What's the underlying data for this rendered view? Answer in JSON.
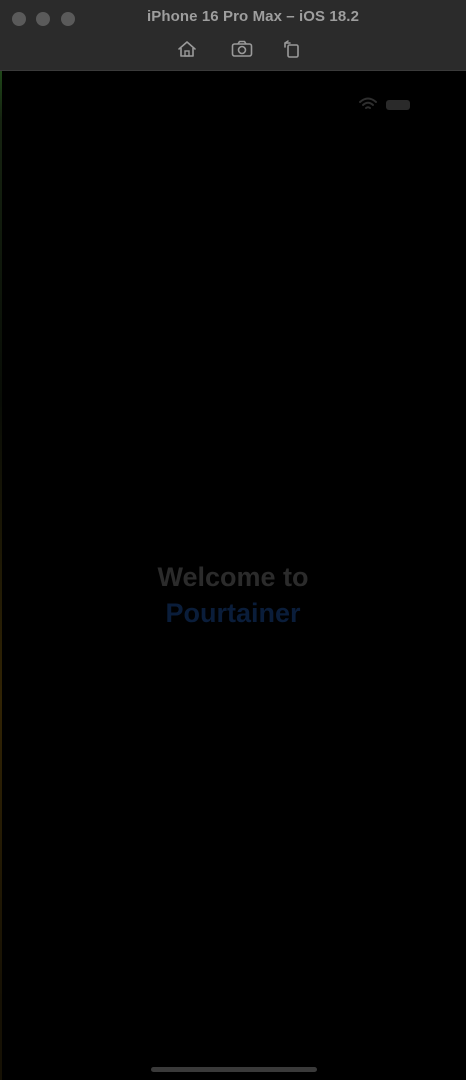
{
  "window": {
    "title": "iPhone 16 Pro Max – iOS 18.2"
  },
  "toolbar": {
    "buttons": [
      {
        "icon": "home-icon"
      },
      {
        "icon": "screenshot-icon"
      },
      {
        "icon": "rotate-icon"
      }
    ]
  },
  "app": {
    "welcome_line1": "Welcome to",
    "welcome_line2": "Pourtainer"
  },
  "colors": {
    "titlebar_bg": "#2b2b2b",
    "screen_bg": "#000000",
    "title_text": "#9e9e9e",
    "welcome_text": "#2b2b2b",
    "brand_text": "#0a1d3a"
  }
}
